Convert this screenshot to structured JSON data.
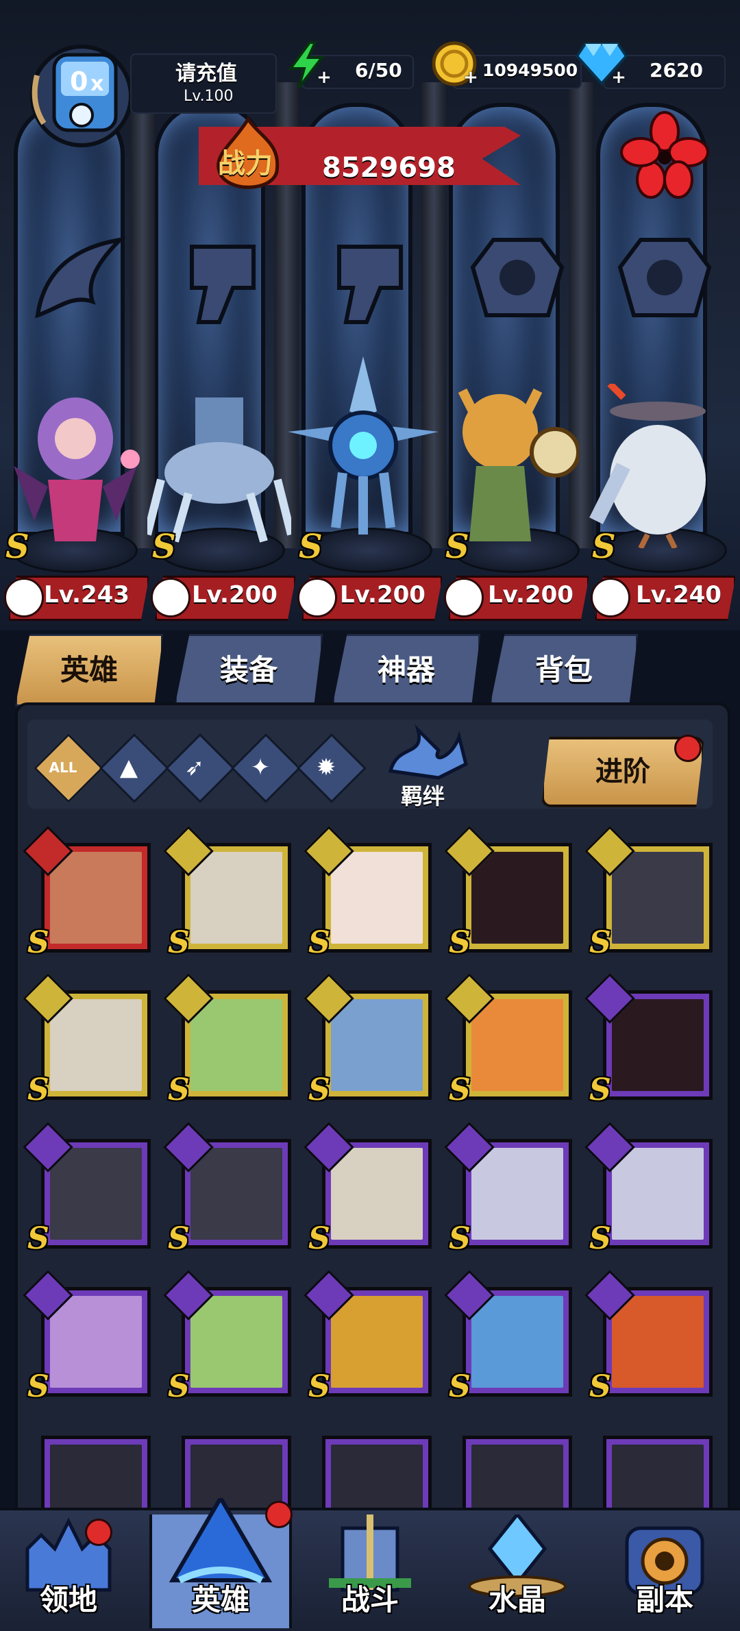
{
  "player": {
    "name": "请充值",
    "level": "Lv.100",
    "energy": "6/50",
    "gold": "10949500",
    "gems": "2620"
  },
  "power": {
    "label": "战力",
    "value": "8529698"
  },
  "display_heroes": [
    {
      "level": "Lv.243",
      "class_icon": "wing-icon"
    },
    {
      "level": "Lv.200",
      "class_icon": "wrench-icon"
    },
    {
      "level": "Lv.200",
      "class_icon": "wrench-icon"
    },
    {
      "level": "Lv.200",
      "class_icon": "beast-icon"
    },
    {
      "level": "Lv.240",
      "class_icon": "beast-icon"
    }
  ],
  "tabs": [
    {
      "label": "英雄"
    },
    {
      "label": "装备"
    },
    {
      "label": "神器"
    },
    {
      "label": "背包"
    }
  ],
  "filters": {
    "all_label": "ALL",
    "bond_label": "羁绊",
    "advance_label": "进阶"
  },
  "nav": [
    {
      "label": "领地"
    },
    {
      "label": "英雄"
    },
    {
      "label": "战斗"
    },
    {
      "label": "水晶"
    },
    {
      "label": "副本"
    }
  ],
  "colors": {
    "rarity_red": "#c32a2a",
    "rarity_gold": "#cfb43a",
    "rarity_purple": "#6d3bb8",
    "accent_gold": "#e8c07a",
    "banner_red": "#b3222a"
  }
}
